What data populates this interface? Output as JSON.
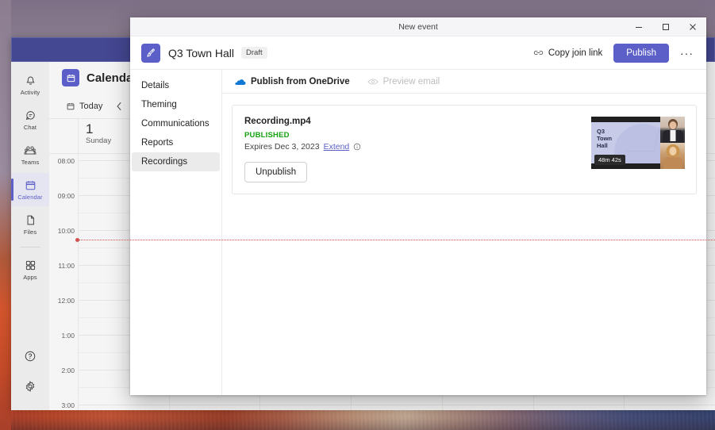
{
  "desktop": {
    "wallpaper": "abstract-landscape"
  },
  "teams_window": {
    "rail": {
      "items": [
        {
          "label": "Activity",
          "icon": "bell-icon",
          "selected": false
        },
        {
          "label": "Chat",
          "icon": "chat-icon",
          "selected": false
        },
        {
          "label": "Teams",
          "icon": "teams-icon",
          "selected": false
        },
        {
          "label": "Calendar",
          "icon": "calendar-icon",
          "selected": true
        },
        {
          "label": "Files",
          "icon": "files-icon",
          "selected": false
        },
        {
          "label": "Apps",
          "icon": "apps-icon",
          "selected": false
        }
      ],
      "bottom": [
        {
          "label": "Help",
          "icon": "help-icon"
        },
        {
          "label": "Settings",
          "icon": "gear-icon"
        }
      ]
    },
    "calendar": {
      "title": "Calendar",
      "app_icon": "calendar-app-icon",
      "today_label": "Today",
      "today_icon": "calendar-today-icon",
      "prev_icon": "chevron-left-icon",
      "next_icon": "chevron-right-icon",
      "day_number": "1",
      "day_name": "Sunday",
      "time_labels": [
        "08:00",
        "09:00",
        "10:00",
        "11:00",
        "12:00",
        "1:00",
        "2:00",
        "3:00"
      ],
      "current_time_indicator": true
    }
  },
  "event_window": {
    "titlebar": {
      "title": "New event",
      "minimize_icon": "minimize-icon",
      "maximize_icon": "maximize-icon",
      "close_icon": "close-icon"
    },
    "header": {
      "app_icon": "town-hall-icon",
      "event_title": "Q3 Town Hall",
      "status_badge": "Draft",
      "copy_join_link": "Copy join link",
      "copy_join_link_icon": "link-icon",
      "publish_label": "Publish",
      "more_label": "···",
      "accent_color": "#5b5fc7"
    },
    "nav": {
      "items": [
        {
          "label": "Details",
          "selected": false
        },
        {
          "label": "Theming",
          "selected": false
        },
        {
          "label": "Communications",
          "selected": false
        },
        {
          "label": "Reports",
          "selected": false
        },
        {
          "label": "Recordings",
          "selected": true
        }
      ]
    },
    "tabs": [
      {
        "label": "Publish from OneDrive",
        "icon": "onedrive-cloud-icon",
        "disabled": false
      },
      {
        "label": "Preview email",
        "icon": "eye-icon",
        "disabled": true
      }
    ],
    "recording": {
      "filename": "Recording.mp4",
      "status": "PUBLISHED",
      "status_color": "#13a10e",
      "expiry_text": "Expires Dec 3, 2023",
      "extend_label": "Extend",
      "info_icon": "info-icon",
      "unpublish_label": "Unpublish",
      "thumbnail": {
        "slide_text": "Q3\nTown\nHall",
        "duration": "48m 42s",
        "participants": 2
      }
    }
  }
}
